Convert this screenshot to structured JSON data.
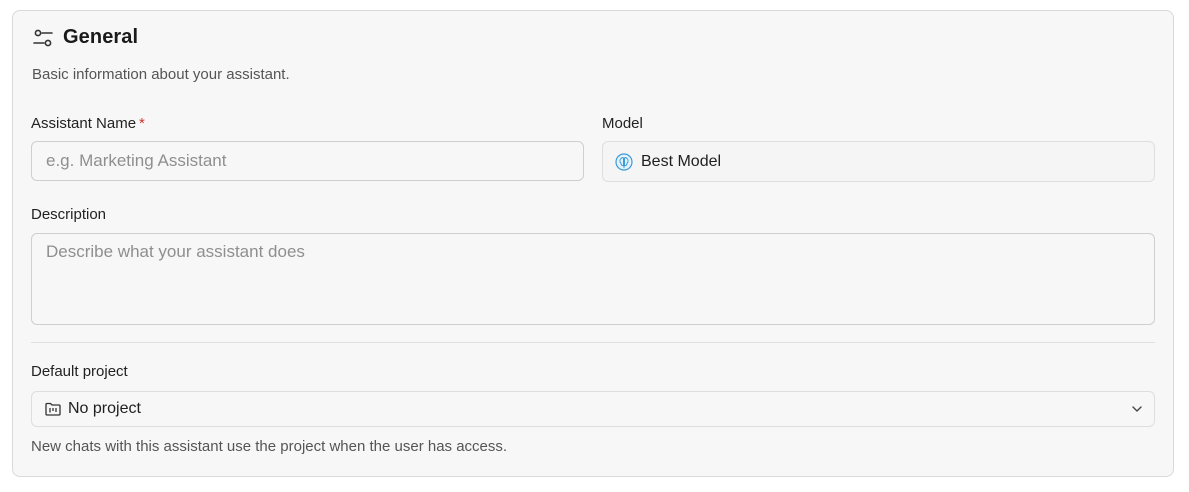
{
  "section": {
    "title": "General",
    "subtitle": "Basic information about your assistant."
  },
  "fields": {
    "name": {
      "label": "Assistant Name",
      "required_mark": "*",
      "placeholder": "e.g. Marketing Assistant",
      "value": ""
    },
    "model": {
      "label": "Model",
      "value": "Best Model",
      "icon": "model-brain-icon"
    },
    "description": {
      "label": "Description",
      "placeholder": "Describe what your assistant does",
      "value": ""
    },
    "project": {
      "label": "Default project",
      "value": "No project",
      "icon": "folder-kanban-icon",
      "hint": "New chats with this assistant use the project when the user has access."
    }
  },
  "colors": {
    "card_bg": "#f7f7f7",
    "border": "#d9d9d9",
    "required": "#d0352c",
    "model_icon": "#3a9bd9"
  }
}
